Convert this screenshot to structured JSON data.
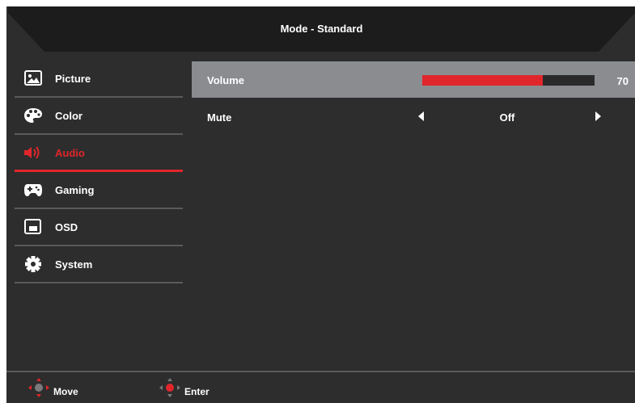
{
  "header": {
    "title": "Mode - Standard"
  },
  "sidebar": {
    "items": [
      {
        "label": "Picture",
        "icon": "picture-icon",
        "active": false
      },
      {
        "label": "Color",
        "icon": "palette-icon",
        "active": false
      },
      {
        "label": "Audio",
        "icon": "speaker-icon",
        "active": true
      },
      {
        "label": "Gaming",
        "icon": "gamepad-icon",
        "active": false
      },
      {
        "label": "OSD",
        "icon": "osd-window-icon",
        "active": false
      },
      {
        "label": "System",
        "icon": "gear-icon",
        "active": false
      }
    ]
  },
  "audio": {
    "volume": {
      "label": "Volume",
      "value": "70",
      "level": 0.7
    },
    "mute": {
      "label": "Mute",
      "value": "Off"
    }
  },
  "footer": {
    "move_label": "Move",
    "enter_label": "Enter"
  },
  "colors": {
    "background": "#2d2d2d",
    "accent": "#e0262b",
    "selected_row": "#8a8c90",
    "divider": "#5a5a5a"
  }
}
